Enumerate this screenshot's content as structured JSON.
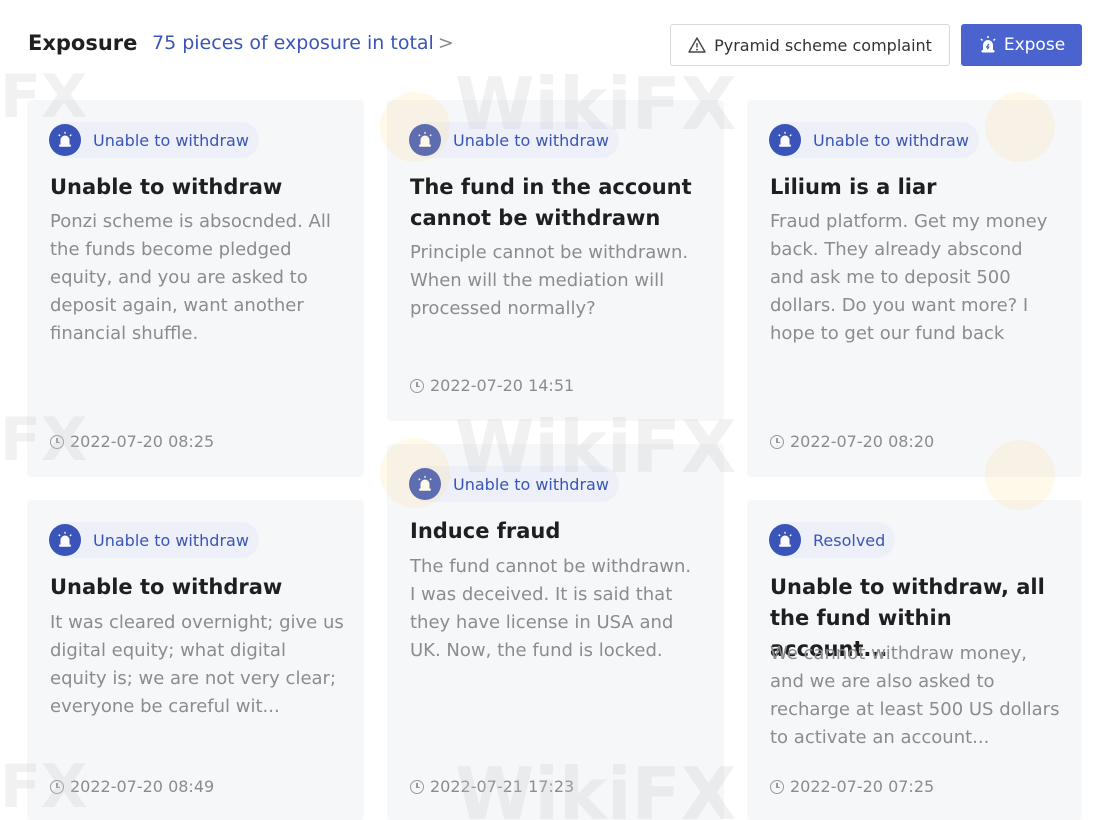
{
  "header": {
    "title": "Exposure",
    "count_text": "75 pieces of exposure in total",
    "chevron": ">",
    "complaint_button": "Pyramid scheme complaint",
    "expose_button": "Expose"
  },
  "watermark": {
    "text": "WikiFX",
    "short": "FX"
  },
  "cards": [
    {
      "tag": "Unable to withdraw",
      "title": "Unable to withdraw",
      "desc": "Ponzi scheme is absocnded. All the funds become pledged equity, and you are asked to deposit again, want another financial shuffle.",
      "time": "2022-07-20 08:25"
    },
    {
      "tag": "Unable to withdraw",
      "title": "The fund in the account cannot be withdrawn",
      "desc": "Principle cannot be withdrawn. When will the mediation will processed normally?",
      "time": "2022-07-20 14:51"
    },
    {
      "tag": "Unable to withdraw",
      "title": "Lilium is a liar",
      "desc": "Fraud platform. Get my money back. They already abscond and ask me to deposit 500 dollars. Do you want more? I hope to get our fund back",
      "time": "2022-07-20 08:20"
    },
    {
      "tag": "Unable to withdraw",
      "title": "Unable to withdraw",
      "desc": "It was cleared overnight; give us digital equity; what digital equity is; we are not very clear; everyone be careful wit...",
      "time": "2022-07-20 08:49"
    },
    {
      "tag": "Unable to withdraw",
      "title": "Induce fraud",
      "desc": "The fund cannot be withdrawn. I was deceived. It is said that they have license in USA and UK. Now, the fund is locked.",
      "time": "2022-07-21 17:23"
    },
    {
      "tag": "Resolved",
      "title": "Unable to withdraw, all the fund within account...",
      "desc": "We cannot withdraw money, and we are also asked to recharge at least 500 US dollars to activate an account...",
      "time": "2022-07-20 07:25"
    }
  ],
  "colors": {
    "accent": "#3a55b7",
    "button": "#4a63cf",
    "card_bg": "#f6f7f9",
    "muted": "#8c8c8c"
  }
}
